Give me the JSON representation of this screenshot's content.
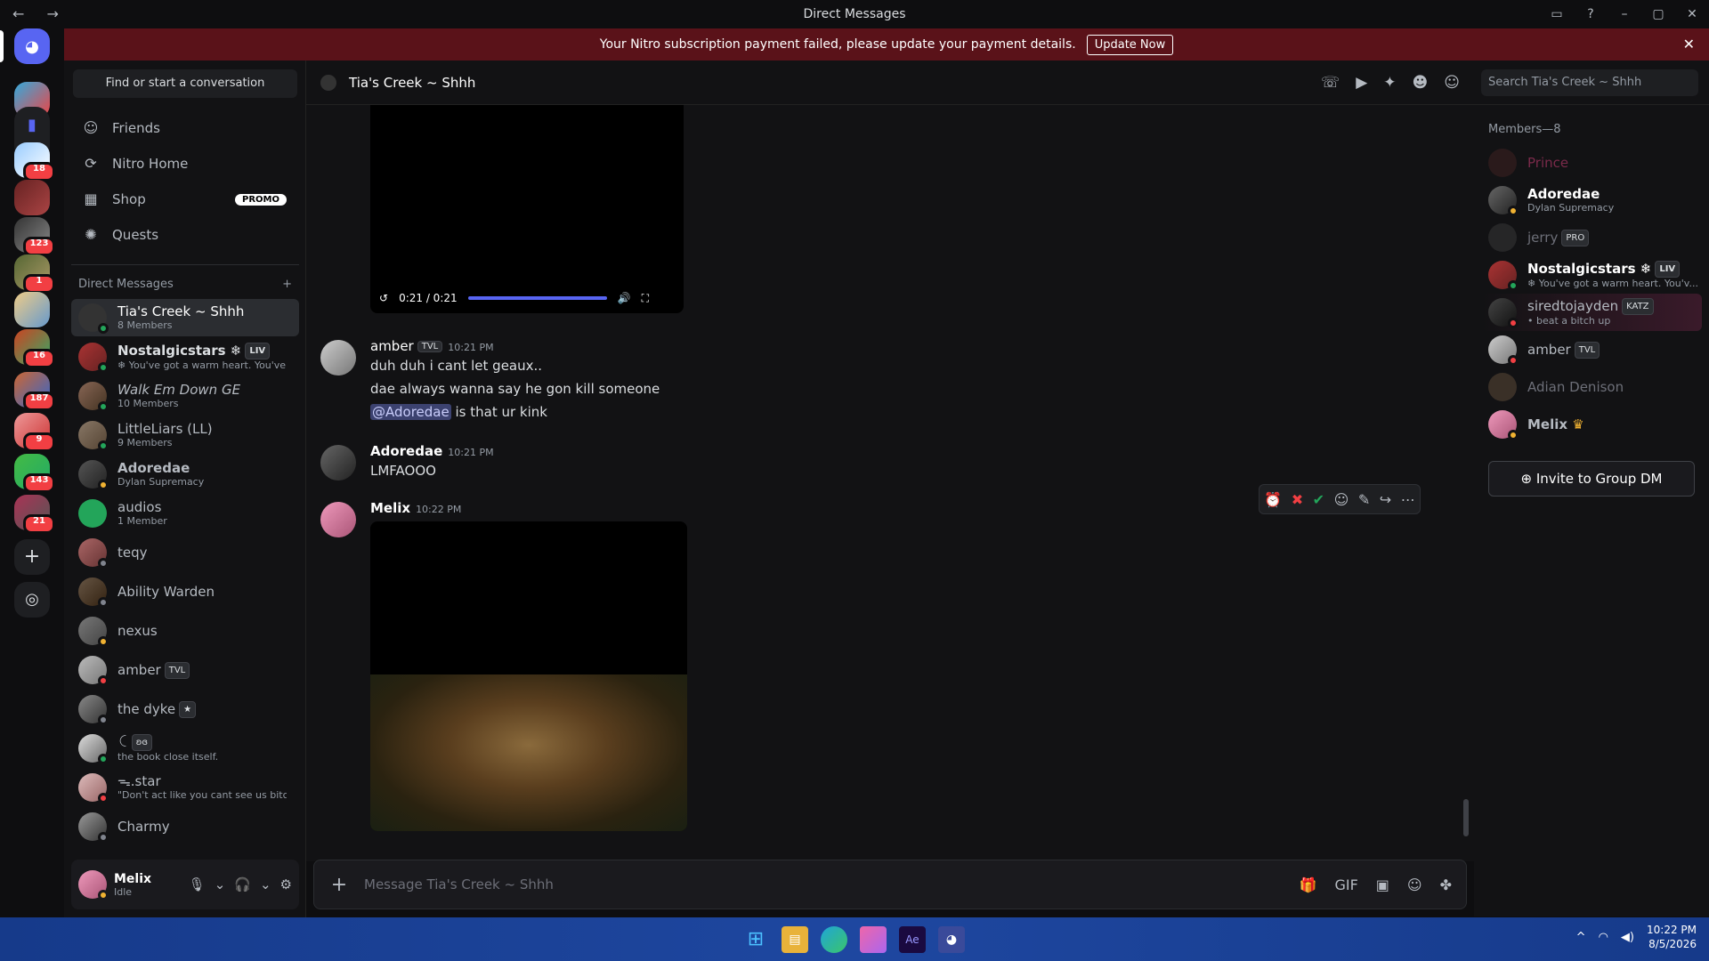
{
  "window": {
    "title": "Direct Messages",
    "nav_glyphs": "← →"
  },
  "banner": {
    "text": "Your Nitro subscription payment failed, please update your payment details.",
    "button": "Update Now"
  },
  "sidebar": {
    "find_placeholder": "Find or start a conversation",
    "nav": [
      {
        "label": "Friends",
        "icon": "friends-icon"
      },
      {
        "label": "Nitro Home",
        "icon": "nitro-icon"
      },
      {
        "label": "Shop",
        "icon": "shop-icon",
        "badge": "PROMO"
      },
      {
        "label": "Quests",
        "icon": "quests-icon"
      }
    ],
    "dm_header": "Direct Messages",
    "dms": [
      {
        "name": "Tia's Creek ~ Shhh",
        "sub": "8 Members"
      },
      {
        "name": "Nostalgicstars ❄",
        "tag": "LIV",
        "sub": "❄ You've got a warm heart. You've ..."
      },
      {
        "name": "Walk Em Down GE",
        "sub": "10 Members"
      },
      {
        "name": "LittleLiars (LL)",
        "sub": "9 Members"
      },
      {
        "name": "Adoredae",
        "sub": "Dylan Supremacy"
      },
      {
        "name": "audios",
        "sub": "1 Member"
      },
      {
        "name": "teqy",
        "sub": ""
      },
      {
        "name": "Ability Warden",
        "sub": ""
      },
      {
        "name": "nexus",
        "sub": ""
      },
      {
        "name": "amber",
        "tag": "TVL",
        "sub": ""
      },
      {
        "name": "the dyke",
        "tag": "★",
        "sub": ""
      },
      {
        "name": "ꉔ",
        "tag": "ʚɞ",
        "sub": "the book close itself."
      },
      {
        "name": "ᯓ.star",
        "sub": "\"Don't act like you cant see us bitch\""
      },
      {
        "name": "Charmy",
        "sub": ""
      }
    ],
    "user": {
      "name": "Melix",
      "status": "Idle"
    }
  },
  "rail_badges": [
    "18",
    "123",
    "1",
    "16",
    "187",
    "9",
    "143",
    "21"
  ],
  "chat": {
    "title": "Tia's Creek ~ Shhh",
    "search_placeholder": "Search Tia's Creek ~ Shhh",
    "video": {
      "time": "0:21 / 0:21",
      "progress": 1.0
    },
    "messages": [
      {
        "author": "amber",
        "tag": "TVL",
        "time": "10:21 PM",
        "lines": [
          "duh duh i cant let geaux..",
          "dae always wanna say he gon kill someone"
        ],
        "mention": "@Adoredae",
        "mention_rest": "is that ur kink"
      },
      {
        "author": "Adoredae",
        "time": "10:21 PM",
        "lines": [
          "LMFAOOO"
        ]
      },
      {
        "author": "Melix",
        "time": "10:22 PM",
        "lines": []
      }
    ],
    "composer_placeholder": "Message Tia's Creek ~ Shhh"
  },
  "members": {
    "header": "Members—8",
    "list": [
      {
        "name": "Prince",
        "sub": "",
        "color": "#7a2a4a"
      },
      {
        "name": "Adoredae",
        "sub": "Dylan Supremacy",
        "color": "#dbdee1"
      },
      {
        "name": "jerry",
        "tag": "PRO",
        "sub": "",
        "color": "#6d6f78"
      },
      {
        "name": "Nostalgicstars ❄",
        "tag": "LIV",
        "sub": "❄ You've got a warm heart. You'v...",
        "color": "#ffffff"
      },
      {
        "name": "siredtojayden",
        "tag": "KATZ",
        "sub": "• beat a bitch up",
        "color": "#b5bac1"
      },
      {
        "name": "amber",
        "tag": "TVL",
        "sub": "",
        "color": "#b5bac1"
      },
      {
        "name": "Adian Denison",
        "sub": "",
        "color": "#6d6f78"
      },
      {
        "name": "Melix",
        "tag": "♛",
        "sub": "",
        "color": "#b5bac1"
      }
    ],
    "invite": "Invite to Group DM"
  },
  "taskbar": {
    "time": "10:22 PM",
    "date": "8/5/2026"
  }
}
